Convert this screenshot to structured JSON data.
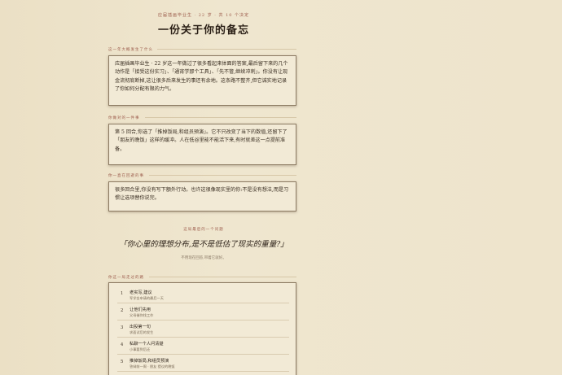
{
  "header": {
    "kicker": "应届插画毕业生 · 22 岁 · 共 10 个决定",
    "title": "一份关于你的备忘"
  },
  "sections": [
    {
      "label": "这一年大概发生了什么",
      "text": "应届插画毕业生 · 22 岁这一年做过了很多看起来体面的答案,最后留下来的几个动作是「接受这份实习」、「通宵学那个工具」、「先不管,继续冲刺」。你没有让现金流彻底断掉,这让很多后来发生的事还有余地。这条路不整齐,但它诚实地记录了你如何分配有限的力气。"
    },
    {
      "label": "你做对的一件事",
      "text": "第 5 回合,你选了「推掉饭局,和组员预演」。它不只改变了当下的数值,还留下了「朋友的晚饭」这样的缓冲。人在低谷里能不能活下来,有时就差这一点提前准备。"
    },
    {
      "label": "你一直在回避的事",
      "text": "很多回合里,你没有写下额外行动。也许这很像现实里的你:不是没有想法,而是习惯让选项替你说完。"
    }
  ],
  "question": {
    "kicker": "这局最后的一个问题",
    "text": "「你心里的理想分布,是不是低估了现实的重量?」",
    "note": "不用现在回答,带着它就好。"
  },
  "list": {
    "label": "你这一局走过的路",
    "items": [
      {
        "num": "1",
        "name": "老实写,建议",
        "sub": "军学金申请的最后一天"
      },
      {
        "num": "2",
        "name": "让他们先用",
        "sub": "父母催你找工作"
      },
      {
        "num": "3",
        "name": "出投第一句",
        "sub": "求面试后的发生"
      },
      {
        "num": "4",
        "name": "私聊一个人问清楚",
        "sub": "小事要到后还"
      },
      {
        "num": "5",
        "name": "推掉饭局,和组员预演",
        "sub": "答辩前一周 · 朋友 提议的晚饭"
      }
    ]
  }
}
